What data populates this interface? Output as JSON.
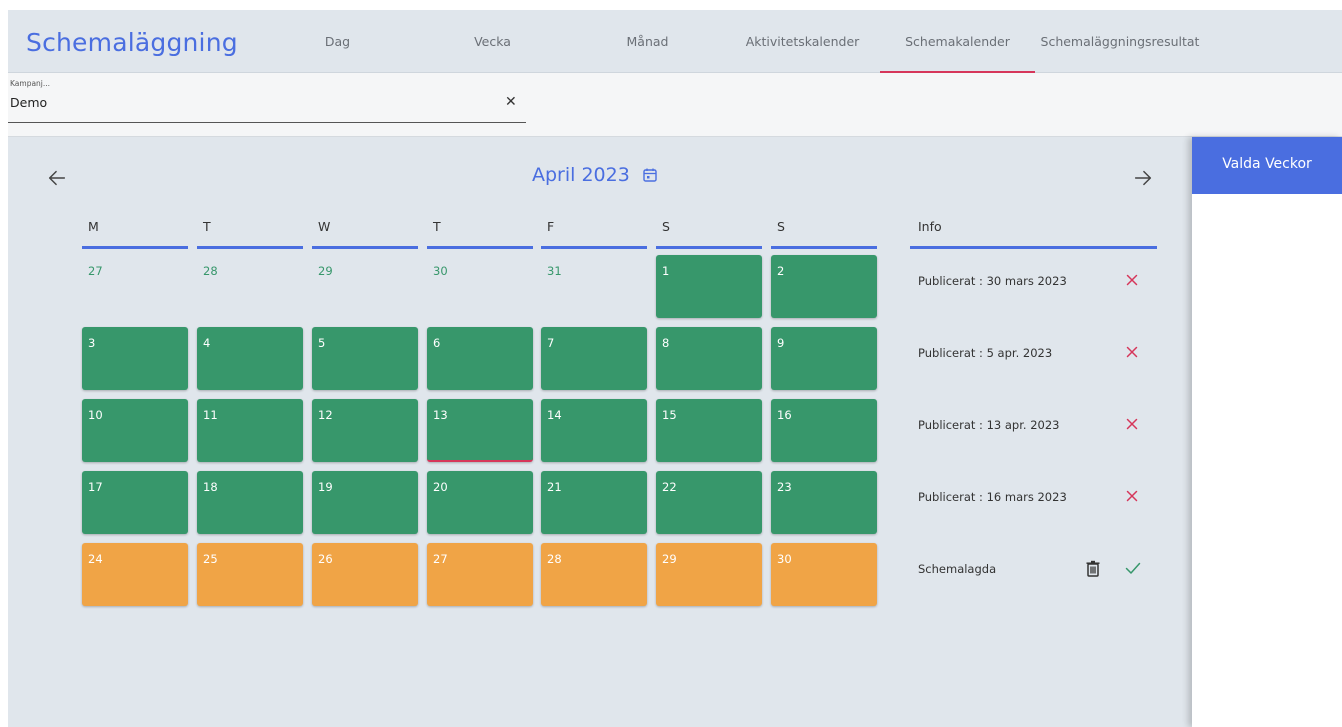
{
  "app": {
    "title": "Schemaläggning"
  },
  "tabs": [
    {
      "label": "Dag"
    },
    {
      "label": "Vecka"
    },
    {
      "label": "Månad"
    },
    {
      "label": "Aktivitetskalender"
    },
    {
      "label": "Schemakalender",
      "active": true
    },
    {
      "label": "Schemaläggningsresultat"
    }
  ],
  "campaign": {
    "label": "Kampanj...",
    "value": "Demo"
  },
  "calendar": {
    "month_label": "April 2023",
    "weekdays": [
      "M",
      "T",
      "W",
      "T",
      "F",
      "S",
      "S"
    ],
    "info_header": "Info",
    "weeks": [
      [
        {
          "day": "27",
          "status": "prev"
        },
        {
          "day": "28",
          "status": "prev"
        },
        {
          "day": "29",
          "status": "prev"
        },
        {
          "day": "30",
          "status": "prev"
        },
        {
          "day": "31",
          "status": "prev"
        },
        {
          "day": "1",
          "status": "published"
        },
        {
          "day": "2",
          "status": "published"
        }
      ],
      [
        {
          "day": "3",
          "status": "published"
        },
        {
          "day": "4",
          "status": "published"
        },
        {
          "day": "5",
          "status": "published"
        },
        {
          "day": "6",
          "status": "published"
        },
        {
          "day": "7",
          "status": "published"
        },
        {
          "day": "8",
          "status": "published"
        },
        {
          "day": "9",
          "status": "published"
        }
      ],
      [
        {
          "day": "10",
          "status": "published"
        },
        {
          "day": "11",
          "status": "published"
        },
        {
          "day": "12",
          "status": "published"
        },
        {
          "day": "13",
          "status": "published",
          "today": true
        },
        {
          "day": "14",
          "status": "published"
        },
        {
          "day": "15",
          "status": "published"
        },
        {
          "day": "16",
          "status": "published"
        }
      ],
      [
        {
          "day": "17",
          "status": "published"
        },
        {
          "day": "18",
          "status": "published"
        },
        {
          "day": "19",
          "status": "published"
        },
        {
          "day": "20",
          "status": "published"
        },
        {
          "day": "21",
          "status": "published"
        },
        {
          "day": "22",
          "status": "published"
        },
        {
          "day": "23",
          "status": "published"
        }
      ],
      [
        {
          "day": "24",
          "status": "scheduled"
        },
        {
          "day": "25",
          "status": "scheduled"
        },
        {
          "day": "26",
          "status": "scheduled"
        },
        {
          "day": "27",
          "status": "scheduled"
        },
        {
          "day": "28",
          "status": "scheduled"
        },
        {
          "day": "29",
          "status": "scheduled"
        },
        {
          "day": "30",
          "status": "scheduled"
        }
      ]
    ],
    "info": [
      {
        "text": "Publicerat : 30 mars 2023",
        "action": "close-icon"
      },
      {
        "text": "Publicerat : 5 apr. 2023",
        "action": "close-icon"
      },
      {
        "text": "Publicerat : 13 apr. 2023",
        "action": "close-icon"
      },
      {
        "text": "Publicerat : 16 mars 2023",
        "action": "close-icon"
      },
      {
        "text": "Schemalagda",
        "action": "check-icon",
        "secondary_action": "trash-icon"
      }
    ]
  },
  "side_panel": {
    "title": "Valda Veckor"
  },
  "colors": {
    "accent": "#4a6ee0",
    "published": "#37976b",
    "scheduled": "#f0a446",
    "active_tab_underline": "#d6365a",
    "remove": "#d6365a",
    "confirm": "#37976b"
  },
  "icons": {
    "prev": "arrow-left-icon",
    "next": "arrow-right-icon",
    "calendar": "calendar-icon",
    "clear": "close-icon"
  }
}
